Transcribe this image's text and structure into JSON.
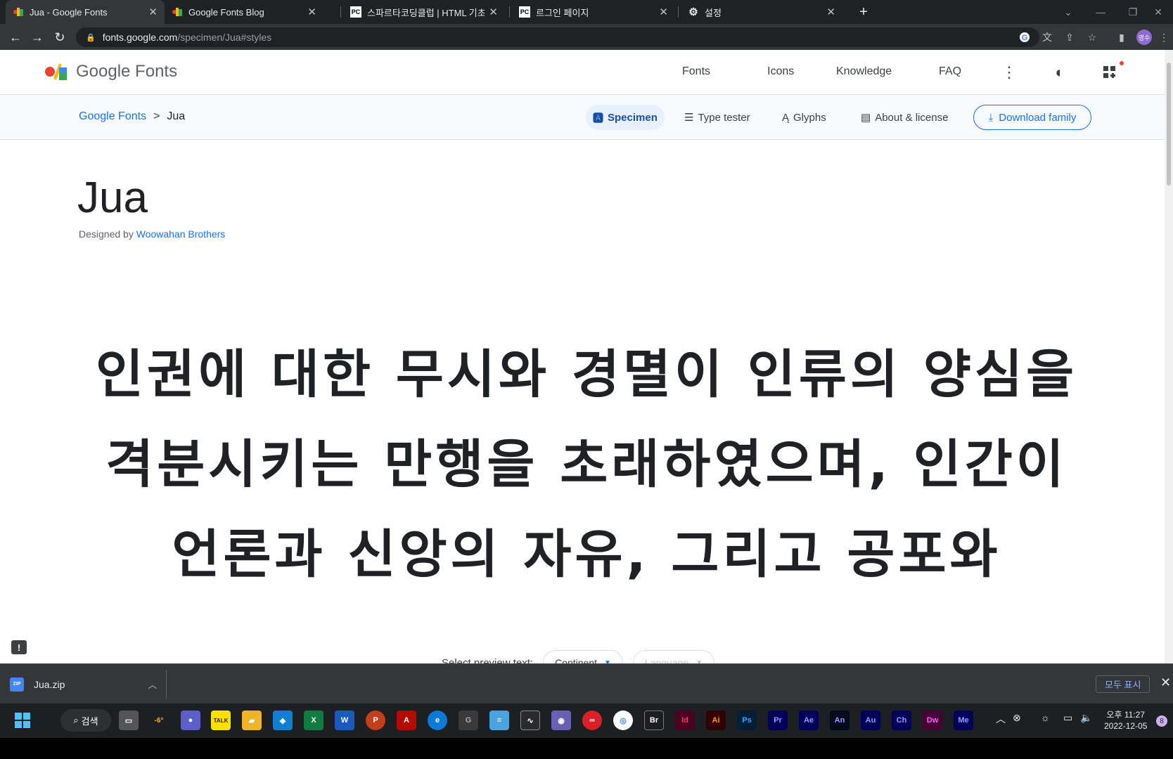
{
  "browser": {
    "tabs": [
      {
        "title": "Jua - Google Fonts",
        "icon": "google-fonts-icon"
      },
      {
        "title": "Google Fonts Blog",
        "icon": "google-fonts-icon"
      },
      {
        "title": "스파르타코딩클럽 | HTML 기초",
        "icon": "pycharm-icon",
        "icon_text": "PC"
      },
      {
        "title": "르그인 페이지",
        "icon": "pycharm-icon",
        "icon_text": "PC"
      },
      {
        "title": "설정",
        "icon": "gear-icon"
      }
    ],
    "new_tab": "+",
    "url_host": "fonts.google.com",
    "url_path": "/specimen/Jua#styles",
    "profile_initials": "영수"
  },
  "header": {
    "logo_text": "Google Fonts",
    "nav": [
      "Fonts",
      "Icons",
      "Knowledge",
      "FAQ"
    ]
  },
  "subbar": {
    "breadcrumb_root": "Google Fonts",
    "breadcrumb_sep": ">",
    "breadcrumb_current": "Jua",
    "tabs": [
      "Specimen",
      "Type tester",
      "Glyphs",
      "About & license"
    ],
    "download_label": "Download family"
  },
  "specimen": {
    "family": "Jua",
    "designed_by": "Designed by",
    "designer": "Woowahan Brothers",
    "sample_lines": [
      "인권에 대한 무시와 경멸이 인류의 양심을",
      "격분시키는 만행을 초래하였으며, 인간이",
      "언론과 신앙의 자유, 그리고 공포와"
    ],
    "select_label": "Select preview text:",
    "continent_label": "Continent",
    "language_label": "Language"
  },
  "downloads": {
    "file": "Jua.zip",
    "zip_badge": "ZIP",
    "show_all": "모두 표시"
  },
  "taskbar": {
    "search_label": "검색",
    "weather": "-6°",
    "apps": [
      "Br",
      "Id",
      "Ai",
      "Ps",
      "Pr",
      "Ae",
      "An",
      "Au",
      "Ch",
      "Dw",
      "Me"
    ],
    "time": "오후 11:27",
    "date": "2022-12-05",
    "notifications": "8"
  },
  "colors": {
    "accent": "#1a73e8",
    "specimen_tab_bg": "#e8f0fe",
    "chrome_dark": "#202124"
  }
}
